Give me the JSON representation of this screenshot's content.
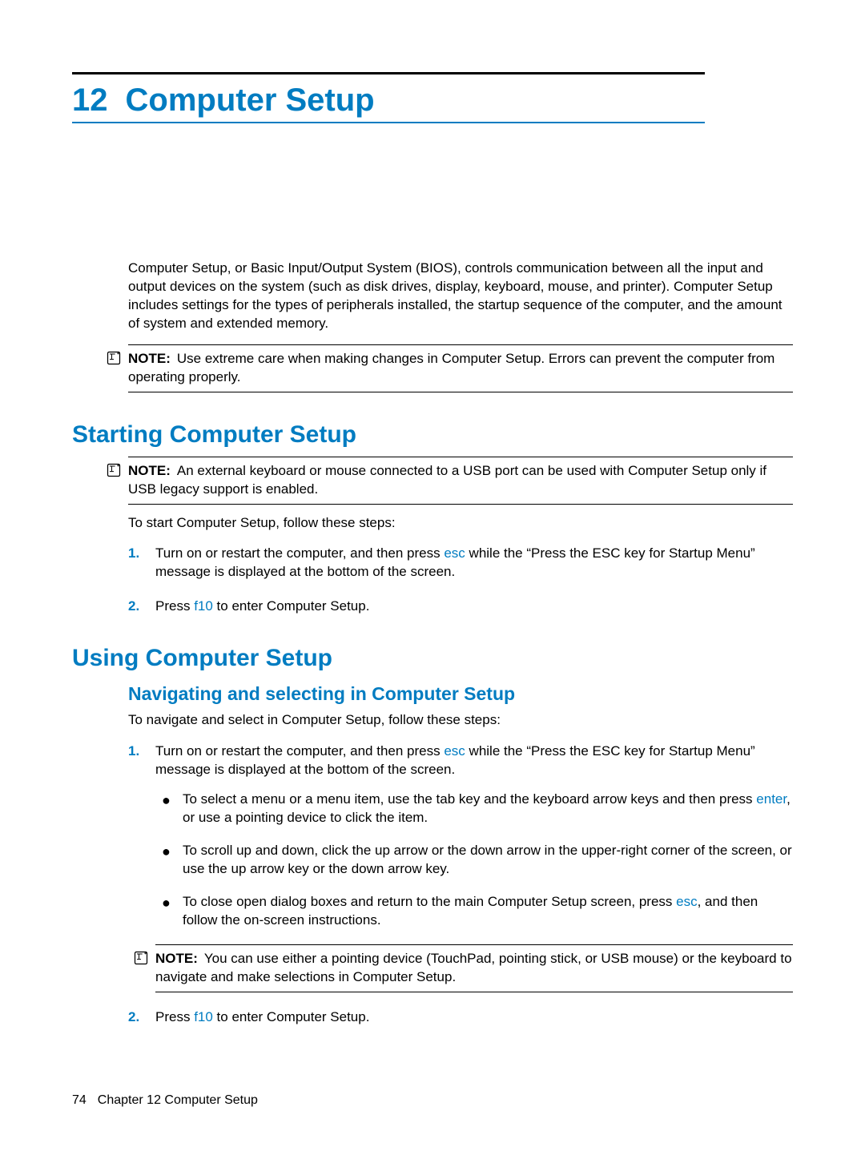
{
  "chapter": {
    "number": "12",
    "title": "Computer Setup"
  },
  "intro": "Computer Setup, or Basic Input/Output System (BIOS), controls communication between all the input and output devices on the system (such as disk drives, display, keyboard, mouse, and printer). Computer Setup includes settings for the types of peripherals installed, the startup sequence of the computer, and the amount of system and extended memory.",
  "noteLabel": "NOTE:",
  "note1": "Use extreme care when making changes in Computer Setup. Errors can prevent the computer from operating properly.",
  "section1": {
    "title": "Starting Computer Setup",
    "note": "An external keyboard or mouse connected to a USB port can be used with Computer Setup only if USB legacy support is enabled.",
    "lead": "To start Computer Setup, follow these steps:",
    "steps": {
      "s1": {
        "num": "1.",
        "pre": "Turn on or restart the computer, and then press ",
        "key": "esc",
        "post": " while the “Press the ESC key for Startup Menu” message is displayed at the bottom of the screen."
      },
      "s2": {
        "num": "2.",
        "pre": "Press ",
        "key": "f10",
        "post": " to enter Computer Setup."
      }
    }
  },
  "section2": {
    "title": "Using Computer Setup",
    "sub1": {
      "title": "Navigating and selecting in Computer Setup",
      "lead": "To navigate and select in Computer Setup, follow these steps:",
      "s1": {
        "num": "1.",
        "pre": "Turn on or restart the computer, and then press ",
        "key": "esc",
        "post": " while the “Press the ESC key for Startup Menu” message is displayed at the bottom of the screen."
      },
      "b1": {
        "pre": "To select a menu or a menu item, use the tab key and the keyboard arrow keys and then press ",
        "key": "enter",
        "post": ", or use a pointing device to click the item."
      },
      "b2": {
        "text": "To scroll up and down, click the up arrow or the down arrow in the upper-right corner of the screen, or use the up arrow key or the down arrow key."
      },
      "b3": {
        "pre": "To close open dialog boxes and return to the main Computer Setup screen, press ",
        "key": "esc",
        "post": ", and then follow the on-screen instructions."
      },
      "note": "You can use either a pointing device (TouchPad, pointing stick, or USB mouse) or the keyboard to navigate and make selections in Computer Setup.",
      "s2": {
        "num": "2.",
        "pre": "Press ",
        "key": "f10",
        "post": " to enter Computer Setup."
      }
    }
  },
  "footer": {
    "pageNum": "74",
    "chapterRef": "Chapter 12   Computer Setup"
  }
}
